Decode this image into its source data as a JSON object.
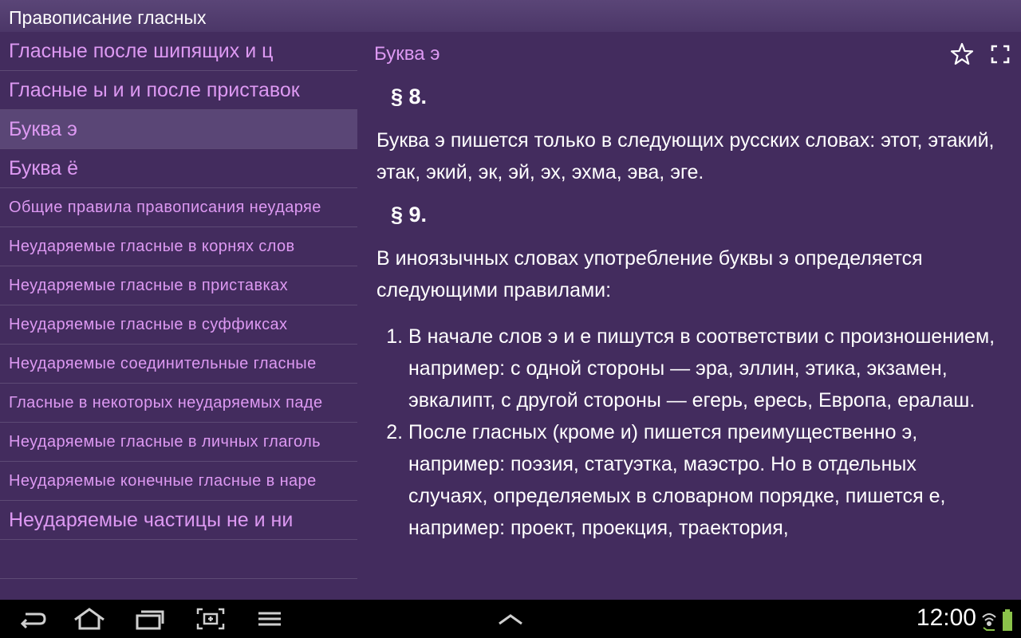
{
  "app": {
    "title": "Правописание гласных"
  },
  "sidebar": {
    "items": [
      {
        "label": "Гласные после шипящих и ц"
      },
      {
        "label": "Гласные ы и и после приставок"
      },
      {
        "label": "Буква э",
        "selected": true
      },
      {
        "label": "Буква ё"
      },
      {
        "label": "Общие правила правописания неударяе"
      },
      {
        "label": "Неударяемые гласные в корнях слов"
      },
      {
        "label": "Неударяемые гласные в приставках"
      },
      {
        "label": "Неударяемые гласные в суффиксах"
      },
      {
        "label": "Неударяемые соединительные гласные"
      },
      {
        "label": "Гласные в некоторых неударяемых паде"
      },
      {
        "label": "Неударяемые гласные в личных глаголь"
      },
      {
        "label": "Неударяемые конечные гласные в наре"
      },
      {
        "label": "Неударяемые частицы не и ни"
      }
    ]
  },
  "main": {
    "title": "Буква э",
    "favorite_icon": "star-outline-icon",
    "fullscreen_icon": "fullscreen-icon",
    "section8": {
      "heading": "§ 8.",
      "text": "Буква э пишется только в следующих русских словах: этот, этакий, этак, экий, эк, эй, эх, эхма, эва, эге."
    },
    "section9": {
      "heading": "§ 9.",
      "intro": "В иноязычных словах употребление буквы э определяется следующими правилами:",
      "rules": [
        "В начале слов э и е пишутся в соответствии с произношением, например: с одной стороны — эра, эллин, этика, экзамен, эвкалипт, с другой стороны — егерь, ересь, Европа, ералаш.",
        "После гласных (кроме и) пишется преимущественно э, например: поэзия, статуэтка, маэстро. Но в отдельных случаях, определяемых в словарном порядке, пишется е, например: проект, проекция, траектория,"
      ]
    }
  },
  "navbar": {
    "buttons": [
      "back-icon",
      "home-icon",
      "recent-apps-icon",
      "screenshot-icon",
      "menu-icon",
      "chevron-up-icon"
    ],
    "clock": "12:00",
    "accent_color": "#8bc34a"
  }
}
